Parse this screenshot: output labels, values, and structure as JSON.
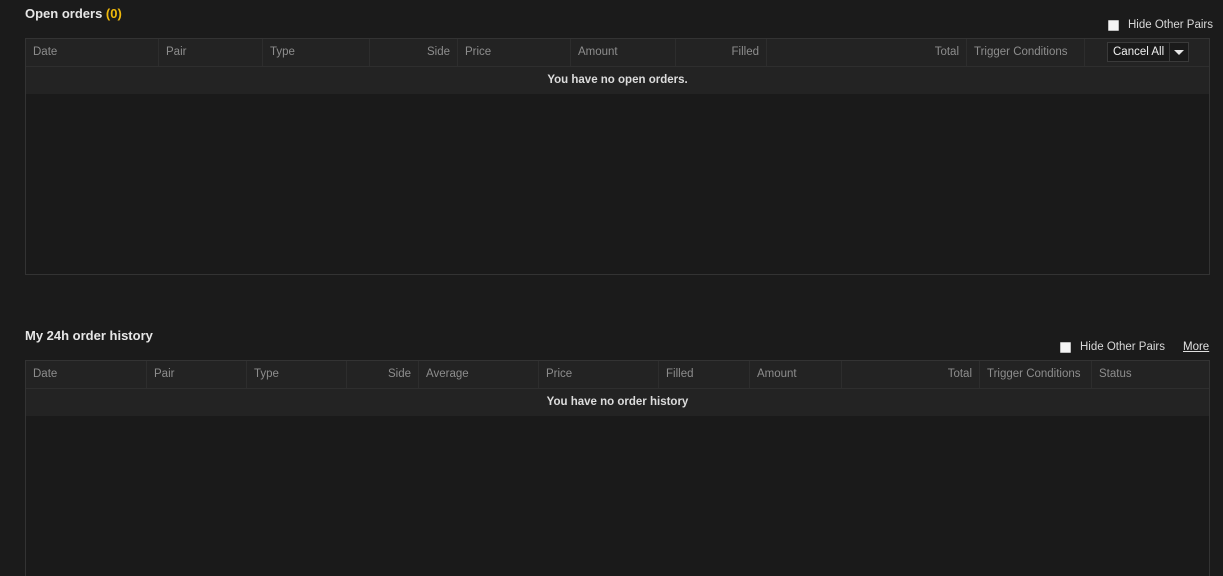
{
  "open_orders": {
    "title": "Open orders",
    "count_open": "(",
    "count": "0",
    "count_close": ")",
    "hide_other_pairs": "Hide Other Pairs",
    "columns": [
      "Date",
      "Pair",
      "Type",
      "Side",
      "Price",
      "Amount",
      "Filled",
      "Total",
      "Trigger Conditions"
    ],
    "cancel_all": "Cancel All",
    "empty_message": "You have no open orders."
  },
  "order_history": {
    "title": "My 24h order history",
    "hide_other_pairs": "Hide Other Pairs",
    "more": "More",
    "columns": [
      "Date",
      "Pair",
      "Type",
      "Side",
      "Average",
      "Price",
      "Filled",
      "Amount",
      "Total",
      "Trigger Conditions",
      "Status"
    ],
    "empty_message": "You have no order history"
  },
  "colors": {
    "background": "#1b1b1b",
    "accent": "#f0b90b"
  }
}
